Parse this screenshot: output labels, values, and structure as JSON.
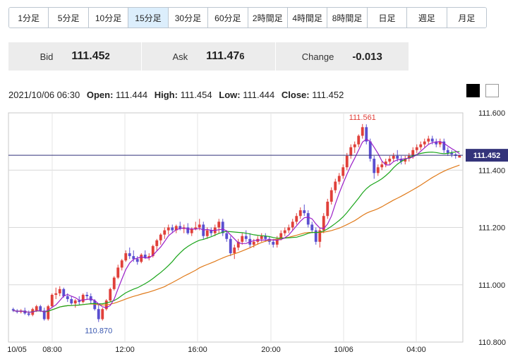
{
  "timeframe_tabs": [
    {
      "label": "1分足",
      "active": false
    },
    {
      "label": "5分足",
      "active": false
    },
    {
      "label": "10分足",
      "active": false
    },
    {
      "label": "15分足",
      "active": true
    },
    {
      "label": "30分足",
      "active": false
    },
    {
      "label": "60分足",
      "active": false
    },
    {
      "label": "2時間足",
      "active": false
    },
    {
      "label": "4時間足",
      "active": false
    },
    {
      "label": "8時間足",
      "active": false
    },
    {
      "label": "日足",
      "active": false
    },
    {
      "label": "週足",
      "active": false
    },
    {
      "label": "月足",
      "active": false
    }
  ],
  "quote": {
    "bid_label": "Bid",
    "bid_main": "111.45",
    "bid_last": "2",
    "ask_label": "Ask",
    "ask_main": "111.47",
    "ask_last": "6",
    "change_label": "Change",
    "change_value": "-0.013"
  },
  "ohlc": {
    "datetime": "2021/10/06 06:30",
    "open_label": "Open:",
    "open": "111.444",
    "high_label": "High:",
    "high": "111.454",
    "low_label": "Low:",
    "low": "111.444",
    "close_label": "Close:",
    "close": "111.452"
  },
  "theme_buttons": {
    "dark": "#000000",
    "light": "#ffffff"
  },
  "colors": {
    "up": "#e0403a",
    "down": "#5a4fd0",
    "ma_short": "#9b1fc8",
    "ma_mid": "#1aa51a",
    "ma_long": "#e07a1a",
    "price_line": "#33337a",
    "price_tag": "#33337a"
  },
  "chart_data": {
    "type": "candlestick",
    "y_range": [
      110.8,
      111.6
    ],
    "y_ticks": [
      "111.600",
      "111.400",
      "111.200",
      "111.000",
      "110.800"
    ],
    "x_tick_labels": [
      "10/05",
      "08:00",
      "12:00",
      "16:00",
      "20:00",
      "10/06",
      "04:00"
    ],
    "current_price": "111.452",
    "high_annotation": {
      "label": "111.561",
      "value": 111.561
    },
    "low_annotation": {
      "label": "110.870",
      "value": 110.87
    },
    "candles": [
      [
        110.915,
        110.92,
        110.905,
        110.91
      ],
      [
        110.91,
        110.915,
        110.9,
        110.905
      ],
      [
        110.905,
        110.915,
        110.9,
        110.91
      ],
      [
        110.91,
        110.92,
        110.895,
        110.9
      ],
      [
        110.9,
        110.91,
        110.89,
        110.895
      ],
      [
        110.895,
        110.92,
        110.89,
        110.915
      ],
      [
        110.91,
        110.93,
        110.905,
        110.925
      ],
      [
        110.925,
        110.93,
        110.905,
        110.91
      ],
      [
        110.91,
        110.92,
        110.875,
        110.88
      ],
      [
        110.88,
        110.93,
        110.875,
        110.925
      ],
      [
        110.925,
        110.97,
        110.92,
        110.965
      ],
      [
        110.965,
        110.99,
        110.95,
        110.97
      ],
      [
        110.97,
        110.995,
        110.96,
        110.985
      ],
      [
        110.985,
        110.99,
        110.955,
        110.96
      ],
      [
        110.96,
        110.97,
        110.94,
        110.95
      ],
      [
        110.95,
        110.96,
        110.93,
        110.935
      ],
      [
        110.935,
        110.95,
        110.92,
        110.945
      ],
      [
        110.945,
        110.96,
        110.93,
        110.94
      ],
      [
        110.94,
        110.97,
        110.935,
        110.965
      ],
      [
        110.965,
        110.975,
        110.95,
        110.96
      ],
      [
        110.96,
        110.97,
        110.935,
        110.945
      ],
      [
        110.945,
        110.95,
        110.91,
        110.915
      ],
      [
        110.915,
        110.93,
        110.87,
        110.88
      ],
      [
        110.88,
        110.92,
        110.875,
        110.915
      ],
      [
        110.915,
        110.95,
        110.91,
        110.945
      ],
      [
        110.945,
        110.99,
        110.94,
        110.985
      ],
      [
        110.985,
        111.03,
        110.98,
        111.025
      ],
      [
        111.025,
        111.07,
        111.02,
        111.06
      ],
      [
        111.06,
        111.09,
        111.05,
        111.085
      ],
      [
        111.085,
        111.12,
        111.08,
        111.11
      ],
      [
        111.11,
        111.13,
        111.09,
        111.1
      ],
      [
        111.1,
        111.12,
        111.08,
        111.09
      ],
      [
        111.09,
        111.1,
        111.07,
        111.08
      ],
      [
        111.08,
        111.11,
        111.075,
        111.105
      ],
      [
        111.105,
        111.12,
        111.09,
        111.095
      ],
      [
        111.095,
        111.11,
        111.085,
        111.1
      ],
      [
        111.1,
        111.14,
        111.095,
        111.135
      ],
      [
        111.135,
        111.16,
        111.12,
        111.155
      ],
      [
        111.155,
        111.18,
        111.14,
        111.175
      ],
      [
        111.175,
        111.2,
        111.16,
        111.19
      ],
      [
        111.19,
        111.21,
        111.175,
        111.2
      ],
      [
        111.2,
        111.21,
        111.18,
        111.19
      ],
      [
        111.19,
        111.21,
        111.18,
        111.205
      ],
      [
        111.205,
        111.22,
        111.19,
        111.195
      ],
      [
        111.195,
        111.21,
        111.18,
        111.2
      ],
      [
        111.2,
        111.215,
        111.175,
        111.18
      ],
      [
        111.18,
        111.2,
        111.17,
        111.195
      ],
      [
        111.195,
        111.22,
        111.19,
        111.2
      ],
      [
        111.2,
        111.23,
        111.19,
        111.21
      ],
      [
        111.21,
        111.22,
        111.16,
        111.17
      ],
      [
        111.17,
        111.2,
        111.16,
        111.19
      ],
      [
        111.19,
        111.2,
        111.17,
        111.18
      ],
      [
        111.18,
        111.21,
        111.17,
        111.2
      ],
      [
        111.2,
        111.23,
        111.18,
        111.22
      ],
      [
        111.22,
        111.23,
        111.17,
        111.18
      ],
      [
        111.18,
        111.19,
        111.15,
        111.16
      ],
      [
        111.16,
        111.17,
        111.1,
        111.11
      ],
      [
        111.11,
        111.14,
        111.09,
        111.13
      ],
      [
        111.13,
        111.16,
        111.12,
        111.15
      ],
      [
        111.15,
        111.18,
        111.14,
        111.17
      ],
      [
        111.17,
        111.19,
        111.15,
        111.16
      ],
      [
        111.16,
        111.18,
        111.13,
        111.14
      ],
      [
        111.14,
        111.16,
        111.13,
        111.15
      ],
      [
        111.15,
        111.17,
        111.14,
        111.16
      ],
      [
        111.16,
        111.18,
        111.15,
        111.17
      ],
      [
        111.17,
        111.18,
        111.15,
        111.16
      ],
      [
        111.16,
        111.17,
        111.14,
        111.15
      ],
      [
        111.15,
        111.16,
        111.13,
        111.14
      ],
      [
        111.14,
        111.17,
        111.13,
        111.16
      ],
      [
        111.16,
        111.19,
        111.155,
        111.18
      ],
      [
        111.18,
        111.2,
        111.17,
        111.19
      ],
      [
        111.19,
        111.21,
        111.18,
        111.2
      ],
      [
        111.2,
        111.23,
        111.19,
        111.22
      ],
      [
        111.22,
        111.25,
        111.21,
        111.24
      ],
      [
        111.24,
        111.27,
        111.23,
        111.26
      ],
      [
        111.26,
        111.28,
        111.24,
        111.25
      ],
      [
        111.25,
        111.26,
        111.2,
        111.21
      ],
      [
        111.21,
        111.22,
        111.18,
        111.19
      ],
      [
        111.19,
        111.2,
        111.14,
        111.15
      ],
      [
        111.15,
        111.2,
        111.13,
        111.19
      ],
      [
        111.19,
        111.25,
        111.18,
        111.24
      ],
      [
        111.24,
        111.3,
        111.23,
        111.29
      ],
      [
        111.29,
        111.34,
        111.28,
        111.33
      ],
      [
        111.33,
        111.37,
        111.32,
        111.36
      ],
      [
        111.36,
        111.39,
        111.35,
        111.38
      ],
      [
        111.38,
        111.42,
        111.37,
        111.41
      ],
      [
        111.41,
        111.46,
        111.4,
        111.45
      ],
      [
        111.45,
        111.49,
        111.44,
        111.48
      ],
      [
        111.48,
        111.5,
        111.46,
        111.49
      ],
      [
        111.49,
        111.525,
        111.48,
        111.52
      ],
      [
        111.52,
        111.561,
        111.51,
        111.55
      ],
      [
        111.55,
        111.56,
        111.49,
        111.5
      ],
      [
        111.5,
        111.51,
        111.43,
        111.44
      ],
      [
        111.44,
        111.45,
        111.37,
        111.39
      ],
      [
        111.39,
        111.42,
        111.38,
        111.41
      ],
      [
        111.41,
        111.43,
        111.4,
        111.42
      ],
      [
        111.42,
        111.44,
        111.41,
        111.43
      ],
      [
        111.43,
        111.45,
        111.42,
        111.44
      ],
      [
        111.44,
        111.46,
        111.43,
        111.45
      ],
      [
        111.45,
        111.47,
        111.43,
        111.44
      ],
      [
        111.44,
        111.45,
        111.42,
        111.43
      ],
      [
        111.43,
        111.45,
        111.42,
        111.44
      ],
      [
        111.44,
        111.46,
        111.43,
        111.45
      ],
      [
        111.45,
        111.48,
        111.44,
        111.47
      ],
      [
        111.47,
        111.49,
        111.46,
        111.48
      ],
      [
        111.48,
        111.5,
        111.47,
        111.49
      ],
      [
        111.49,
        111.51,
        111.48,
        111.5
      ],
      [
        111.5,
        111.52,
        111.49,
        111.51
      ],
      [
        111.51,
        111.52,
        111.49,
        111.5
      ],
      [
        111.5,
        111.51,
        111.48,
        111.49
      ],
      [
        111.49,
        111.51,
        111.48,
        111.5
      ],
      [
        111.5,
        111.51,
        111.46,
        111.47
      ],
      [
        111.47,
        111.48,
        111.45,
        111.46
      ],
      [
        111.46,
        111.47,
        111.445,
        111.455
      ],
      [
        111.455,
        111.46,
        111.44,
        111.45
      ],
      [
        111.444,
        111.454,
        111.444,
        111.452
      ]
    ],
    "ma_periods": {
      "short": 5,
      "mid": 20,
      "long": 40
    }
  }
}
